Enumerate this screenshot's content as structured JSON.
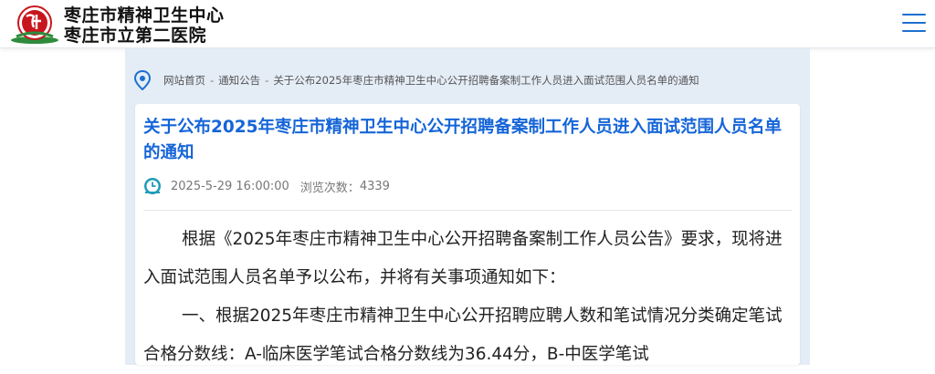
{
  "header": {
    "brand_line1": "枣庄市精神卫生中心",
    "brand_line2": "枣庄市立第二医院",
    "accent_color": "#1c6fd1"
  },
  "breadcrumb": {
    "home": "网站首页",
    "section": "通知公告",
    "current": "关于公布2025年枣庄市精神卫生中心公开招聘备案制工作人员进入面试范围人员名单的通知",
    "separator": "-"
  },
  "article": {
    "title": "关于公布2025年枣庄市精神卫生中心公开招聘备案制工作人员进入面试范围人员名单的通知",
    "date": "2025-5-29 16:00:00",
    "views_label": "浏览次数：",
    "views": "4339",
    "paragraphs": [
      "根据《2025年枣庄市精神卫生中心公开招聘备案制工作人员公告》要求，现将进入面试范围人员名单予以公布，并将有关事项通知如下：",
      "一、根据2025年枣庄市精神卫生中心公开招聘应聘人数和笔试情况分类确定笔试合格分数线：A-临床医学笔试合格分数线为36.44分，B-中医学笔试"
    ],
    "title_color": "#1565d8"
  }
}
